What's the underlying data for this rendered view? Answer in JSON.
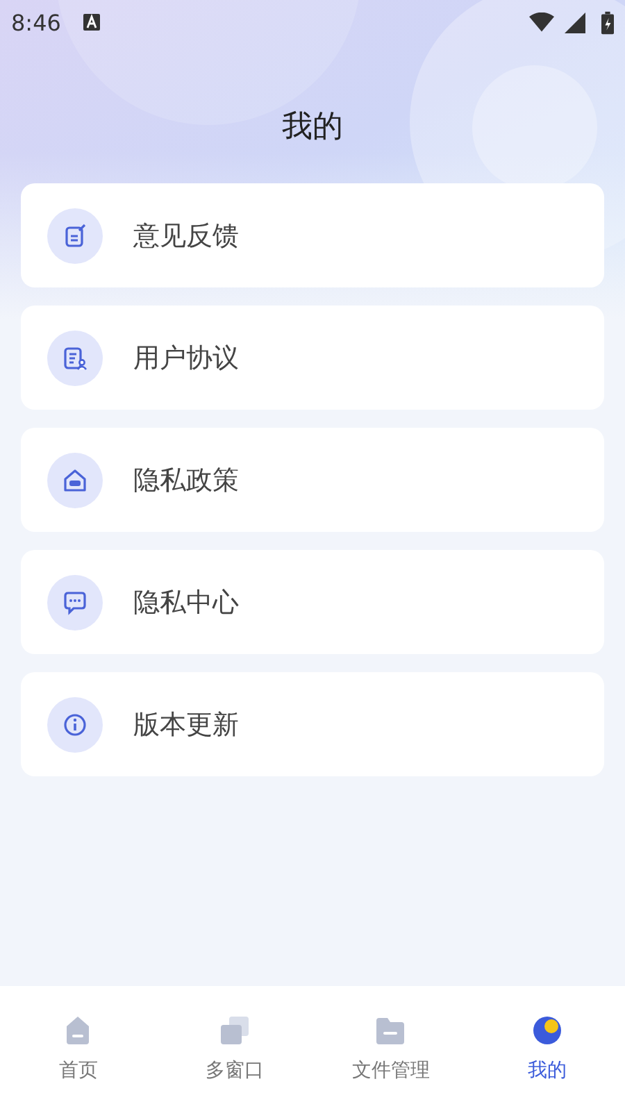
{
  "status_bar": {
    "time": "8:46"
  },
  "header": {
    "title": "我的"
  },
  "menu": [
    {
      "label": "意见反馈"
    },
    {
      "label": "用户协议"
    },
    {
      "label": "隐私政策"
    },
    {
      "label": "隐私中心"
    },
    {
      "label": "版本更新"
    }
  ],
  "bottom_nav": [
    {
      "label": "首页",
      "selected": false
    },
    {
      "label": "多窗口",
      "selected": false
    },
    {
      "label": "文件管理",
      "selected": false
    },
    {
      "label": "我的",
      "selected": true
    }
  ]
}
